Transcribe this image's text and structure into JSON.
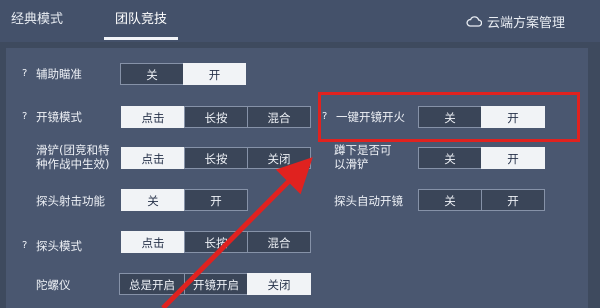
{
  "tabs": {
    "classic": "经典模式",
    "team": "团队竞技"
  },
  "cloud": {
    "label": "云端方案管理",
    "icon": "cloud-icon"
  },
  "settings": {
    "aim_assist": {
      "label": "辅助瞄准",
      "off": "关",
      "on": "开"
    },
    "scope_mode": {
      "label": "开镜模式",
      "tap": "点击",
      "hold": "长按",
      "mix": "混合"
    },
    "one_key_fire": {
      "label": "一键开镜开火",
      "off": "关",
      "on": "开"
    },
    "slide": {
      "label": "滑铲(团竞和特种作战中生效)",
      "tap": "点击",
      "hold": "长按",
      "close": "关闭"
    },
    "crouch_slide": {
      "label": "蹲下是否可以滑铲",
      "off": "关",
      "on": "开"
    },
    "peek_fire": {
      "label": "探头射击功能",
      "off": "关",
      "on": "开"
    },
    "peek_auto_scope": {
      "label": "探头自动开镜",
      "off": "关",
      "on": "开"
    },
    "peek_mode": {
      "label": "探头模式",
      "tap": "点击",
      "hold": "长按",
      "mix": "混合"
    },
    "gyro": {
      "label": "陀螺仪",
      "always": "总是开启",
      "scope": "开镜开启",
      "close": "关闭"
    }
  },
  "help_mark": "?",
  "accent": {
    "highlight": "#e0221f",
    "selected": "#f1f3f6"
  }
}
